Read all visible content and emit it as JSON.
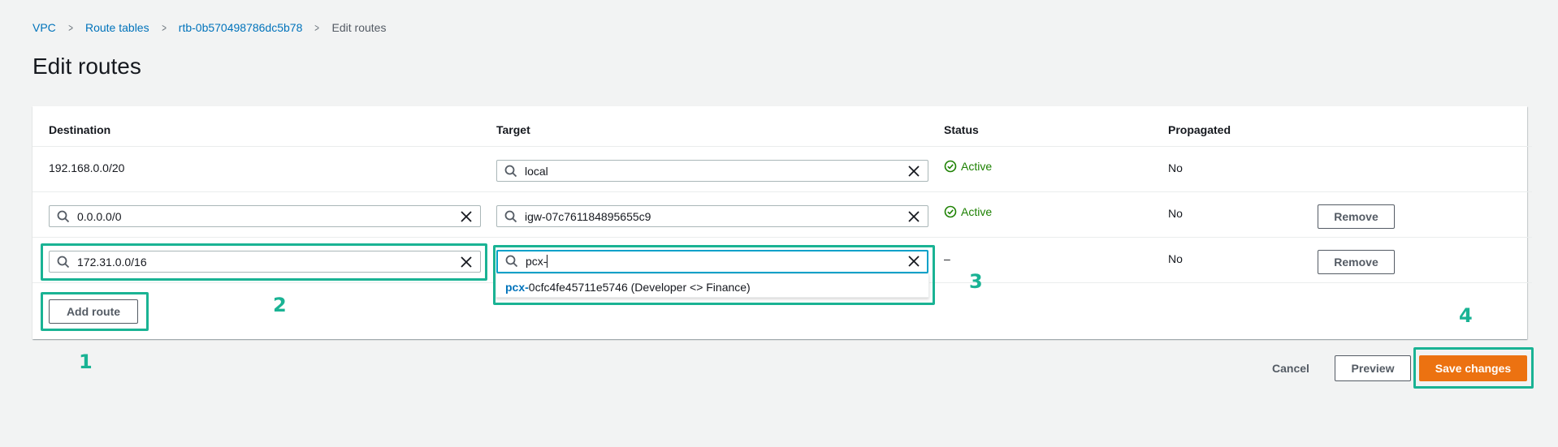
{
  "breadcrumb": {
    "items": [
      "VPC",
      "Route tables",
      "rtb-0b570498786dc5b78"
    ],
    "current": "Edit routes"
  },
  "page_title": "Edit routes",
  "table": {
    "headers": {
      "destination": "Destination",
      "target": "Target",
      "status": "Status",
      "propagated": "Propagated"
    },
    "rows": [
      {
        "destination": "192.168.0.0/20",
        "target": "local",
        "status": "Active",
        "propagated": "No"
      },
      {
        "destination": "0.0.0.0/0",
        "target": "igw-07c761184895655c9",
        "status": "Active",
        "propagated": "No",
        "remove": "Remove"
      },
      {
        "destination": "172.31.0.0/16",
        "target": "pcx-",
        "status": "–",
        "propagated": "No",
        "remove": "Remove"
      }
    ],
    "dropdown_option": {
      "match": "pcx-",
      "rest": "0cfc4fe45711e5746 (Developer <> Finance)"
    },
    "add_route": "Add route"
  },
  "actions": {
    "cancel": "Cancel",
    "preview": "Preview",
    "save": "Save changes"
  },
  "steps": [
    "1",
    "2",
    "3",
    "4"
  ],
  "colors": {
    "link": "#0073bb",
    "active": "#1d8102",
    "primary": "#ec7211",
    "highlight": "#1ab394"
  },
  "icons": [
    "search-icon",
    "clear-icon",
    "status-success-icon",
    "chevron-right-icon"
  ]
}
